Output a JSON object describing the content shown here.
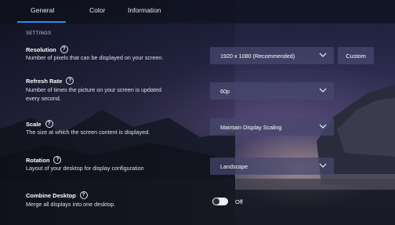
{
  "tabs": [
    {
      "label": "General"
    },
    {
      "label": "Color"
    },
    {
      "label": "Information"
    }
  ],
  "section_title": "SETTINGS",
  "resolution": {
    "title": "Resolution",
    "desc": "Number of pixels that can be displayed on your screen.",
    "value": "1920 x 1080 (Recommended)",
    "custom_label": "Custom"
  },
  "refresh_rate": {
    "title": "Refresh Rate",
    "desc_line1": "Number of times the picture on your screen is updated",
    "desc_line2": "every second.",
    "value": "60p"
  },
  "scale": {
    "title": "Scale",
    "desc": "The size at which the screen content is displayed.",
    "value": "Maintain Display Scaling"
  },
  "rotation": {
    "title": "Rotation",
    "desc": "Layout of your desktop for display configuration",
    "value": "Landscape"
  },
  "combine_desktop": {
    "title": "Combine Desktop",
    "desc": "Merge all displays into one desktop.",
    "state": "Off"
  },
  "icons": {
    "help": "question-circle-icon",
    "dropdown": "chevron-down-icon"
  },
  "colors": {
    "accent": "#2d8cf0",
    "control_bg": "#46486e"
  }
}
